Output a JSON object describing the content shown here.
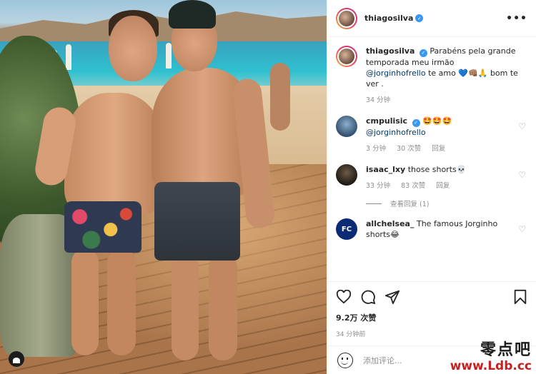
{
  "post": {
    "username": "thiagosilva",
    "verified_mark": "✓",
    "more_label": "•••"
  },
  "caption": {
    "username": "thiagosilva",
    "text_before": "Parabéns pela grande temporada meu irmão",
    "mention": "@jorginhofrello",
    "text_after": "te amo 💙👊🏽🙏 bom te ver .",
    "time": "34 分钟"
  },
  "comments": [
    {
      "username": "cmpulisic",
      "verified": true,
      "text": "🤩🤩🤩",
      "mention": "@jorginhofrello",
      "time": "3 分钟",
      "likes": "30 次赞",
      "reply": "回复"
    },
    {
      "username": "isaac_lxy",
      "verified": false,
      "text": "those shorts💀",
      "mention": "",
      "time": "33 分钟",
      "likes": "83 次赞",
      "reply": "回复",
      "view_replies": "查看回复 (1)"
    },
    {
      "username": "allchelsea_",
      "verified": false,
      "avatar_text": "FC",
      "text": "The famous Jorginho shorts😂",
      "mention": "",
      "time": "",
      "likes": "",
      "reply": ""
    }
  ],
  "actions": {
    "likes": "9.2万 次赞",
    "posted": "34 分钟前"
  },
  "add_comment": {
    "placeholder": "添加评论..."
  },
  "watermark": {
    "cn": "零点吧",
    "url": "www.Ldb.cc"
  },
  "icons": [
    "heart-icon",
    "comment-icon",
    "share-icon",
    "bookmark-icon",
    "smile-icon",
    "more-icon",
    "verified-icon",
    "heart-small-icon"
  ],
  "colors": {
    "verified": "#3897f0",
    "mention": "#00376b",
    "meta": "#8e8e8e",
    "watermark_url": "#c62020"
  }
}
